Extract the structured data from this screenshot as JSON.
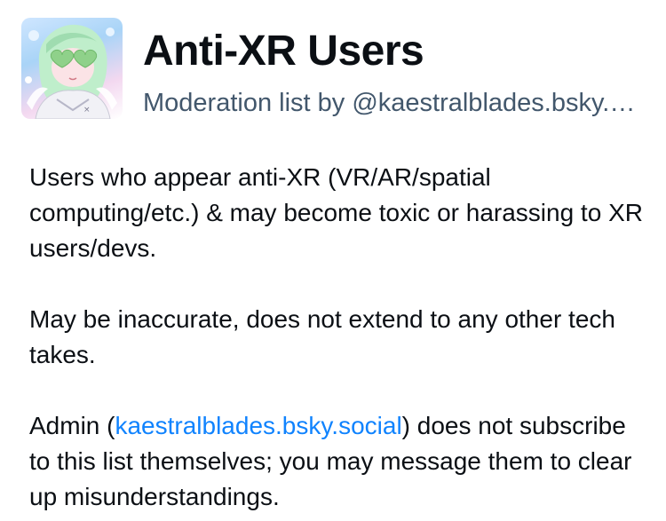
{
  "list": {
    "title": "Anti-XR Users",
    "subtitle": "Moderation list by @kaestralblades.bsky.social",
    "avatar_alt": "list-avatar-anime-character"
  },
  "description": {
    "paragraph1": "Users who appear anti-XR (VR/AR/spatial computing/etc.) & may become toxic or harassing to XR users/devs.",
    "paragraph2": "May be inaccurate, does not extend to any other tech takes.",
    "paragraph3_prefix": "Admin (",
    "paragraph3_link": "kaestralblades.bsky.social",
    "paragraph3_suffix": ") does not subscribe to this list themselves; you may message them to clear up misunderstandings."
  },
  "colors": {
    "text": "#0b0f14",
    "subtitle": "#42576c",
    "link": "#1083fe",
    "background": "#ffffff"
  }
}
